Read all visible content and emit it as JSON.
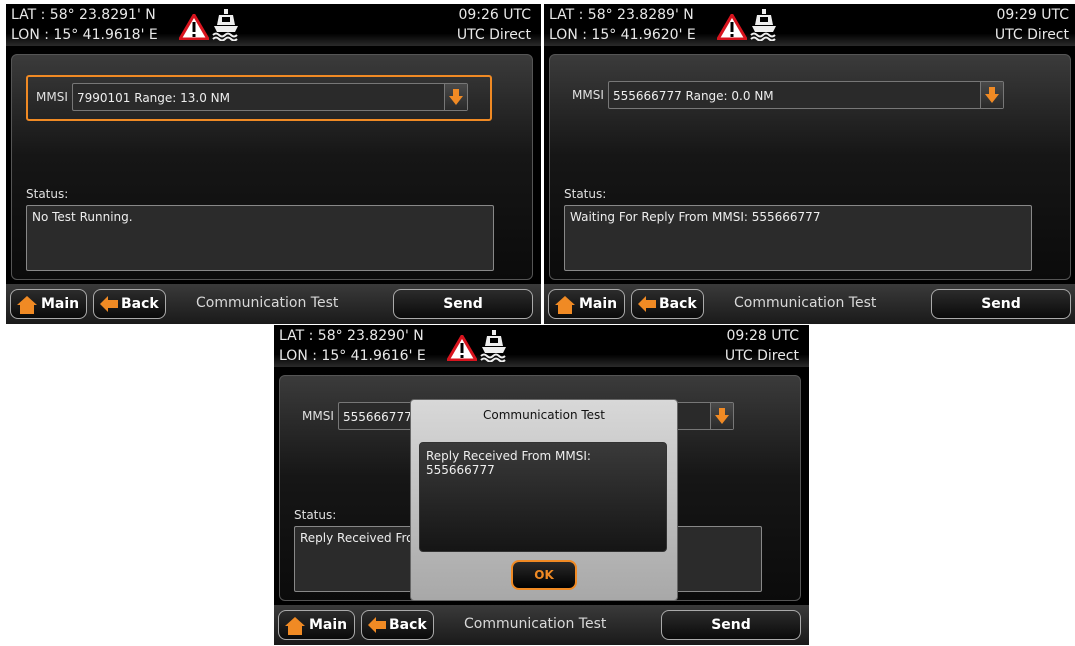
{
  "screens": [
    {
      "lat": "LAT : 58° 23.8291' N",
      "lon": "LON : 15° 41.9618' E",
      "time": "09:26 UTC",
      "mode": "UTC Direct",
      "mmsi_label": "MMSI",
      "mmsi_value": "7990101 Range: 13.0 NM",
      "status_label": "Status:",
      "status_text": "No Test Running.",
      "main_label": "Main",
      "back_label": "Back",
      "title": "Communication Test",
      "send_label": "Send"
    },
    {
      "lat": "LAT : 58° 23.8289' N",
      "lon": "LON : 15° 41.9620' E",
      "time": "09:29 UTC",
      "mode": "UTC Direct",
      "mmsi_label": "MMSI",
      "mmsi_value": "555666777 Range: 0.0 NM",
      "status_label": "Status:",
      "status_text": "Waiting For Reply From MMSI: 555666777",
      "main_label": "Main",
      "back_label": "Back",
      "title": "Communication Test",
      "send_label": "Send"
    },
    {
      "lat": "LAT : 58° 23.8290' N",
      "lon": "LON : 15° 41.9616' E",
      "time": "09:28 UTC",
      "mode": "UTC Direct",
      "mmsi_label": "MMSI",
      "mmsi_value": "555666777",
      "status_label": "Status:",
      "status_text": "Reply Received Fro",
      "main_label": "Main",
      "back_label": "Back",
      "title": "Communication Test",
      "send_label": "Send",
      "dialog": {
        "title": "Communication Test",
        "message": "Reply Received From MMSI: 555666777",
        "ok_label": "OK"
      }
    }
  ],
  "icons": {
    "warning": "warning-triangle-icon",
    "ship": "ship-icon",
    "home": "home-icon",
    "back": "back-arrow-icon",
    "dropdown": "dropdown-arrow-icon"
  },
  "colors": {
    "accent": "#f08a24",
    "warning_red": "#d8141e"
  }
}
